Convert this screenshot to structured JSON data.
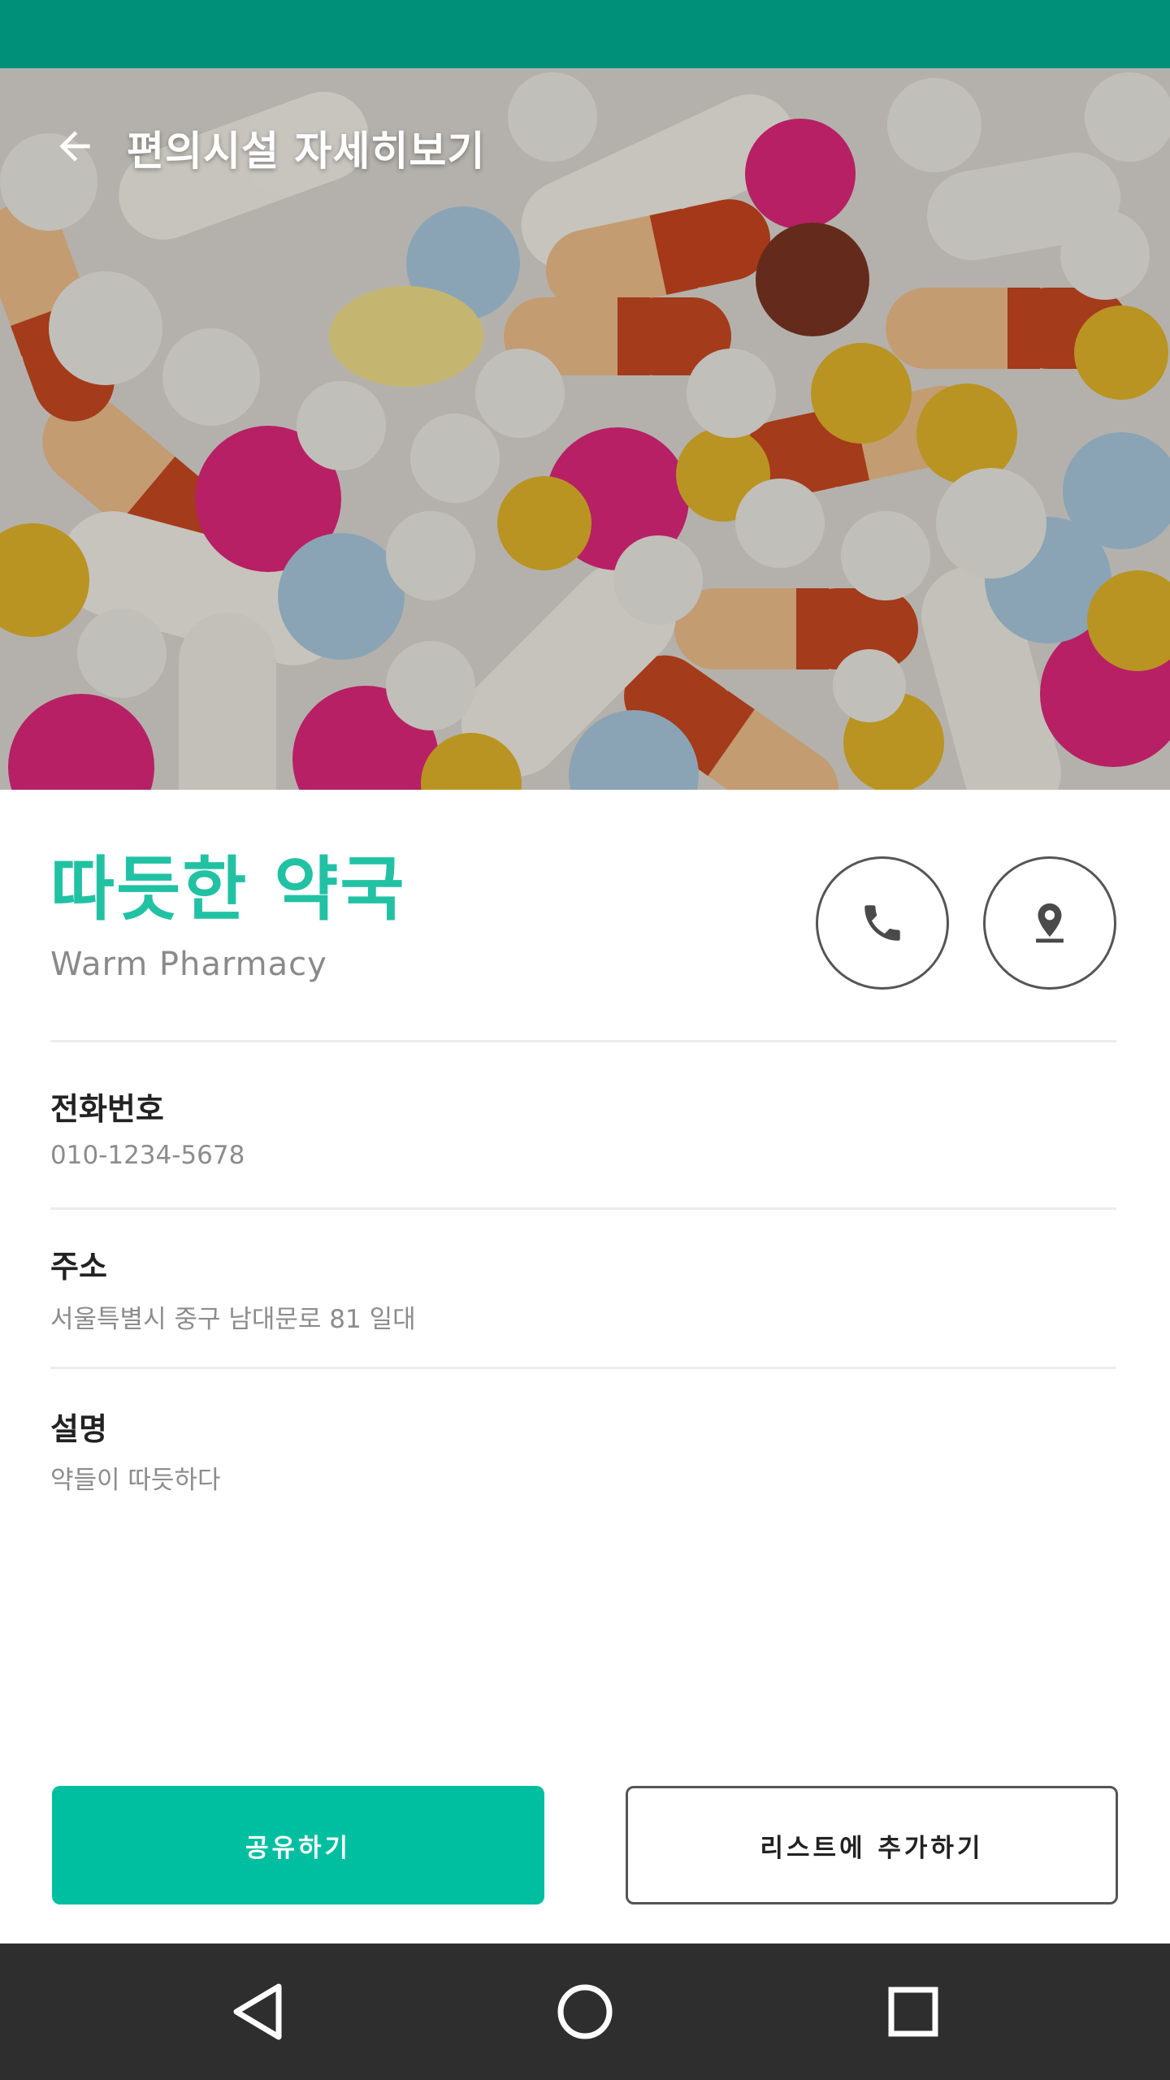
{
  "app_bar": {
    "title": "편의시설 자세히보기",
    "back_icon": "arrow-back-icon"
  },
  "hero": {
    "image_subject": "pills"
  },
  "facility": {
    "name_ko": "따듯한 약국",
    "name_en": "Warm Pharmacy"
  },
  "actions": {
    "call_icon": "phone-icon",
    "map_icon": "location-pin-icon"
  },
  "fields": {
    "phone": {
      "label": "전화번호",
      "value": "010-1234-5678"
    },
    "address": {
      "label": "주소",
      "value": "서울특별시 중구 남대문로 81 일대"
    },
    "description": {
      "label": "설명",
      "value": "약들이 따듯하다"
    }
  },
  "buttons": {
    "share_label": "공유하기",
    "add_to_list_label": "리스트에 추가하기"
  },
  "colors": {
    "status_bar": "#00907a",
    "accent": "#21c2a4",
    "primary_button": "#00bfa0",
    "nav_bar": "#2e2e2e"
  },
  "nav_icons": [
    "back-triangle-icon",
    "home-circle-icon",
    "recents-square-icon"
  ]
}
